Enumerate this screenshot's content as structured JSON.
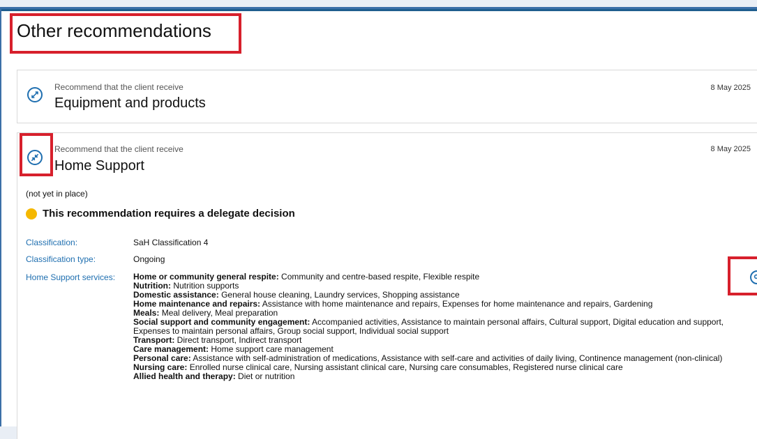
{
  "page": {
    "title": "Other recommendations",
    "colors": {
      "accent": "#1f6fb0",
      "annotation": "#d7202c",
      "warning_dot": "#f5b800"
    }
  },
  "cards": {
    "equipment": {
      "subtitle": "Recommend that the client receive",
      "title": "Equipment and products",
      "date": "8 May 2025",
      "icon": "expand-icon"
    },
    "home_support": {
      "subtitle": "Recommend that the client receive",
      "title": "Home Support",
      "date": "8 May 2025",
      "icon": "collapse-icon",
      "status": "(not yet in place)",
      "delegate_notice": "This recommendation requires a delegate decision",
      "classification_label": "Classification:",
      "classification_value": "SaH Classification 4",
      "classification_type_label": "Classification type:",
      "classification_type_value": "Ongoing",
      "services_label": "Home Support services:",
      "services": [
        {
          "name": "Home or community general respite:",
          "detail": " Community and centre-based respite, Flexible respite"
        },
        {
          "name": "Nutrition:",
          "detail": " Nutrition supports"
        },
        {
          "name": "Domestic assistance:",
          "detail": " General house cleaning, Laundry services, Shopping assistance"
        },
        {
          "name": "Home maintenance and repairs:",
          "detail": " Assistance with home maintenance and repairs, Expenses for home maintenance and repairs, Gardening"
        },
        {
          "name": "Meals:",
          "detail": " Meal delivery, Meal preparation"
        },
        {
          "name": "Social support and community engagement:",
          "detail": " Accompanied activities, Assistance to maintain personal affairs, Cultural support, Digital education and support, Expenses to maintain personal affairs, Group social support, Individual social support"
        },
        {
          "name": "Transport:",
          "detail": " Direct transport, Indirect transport"
        },
        {
          "name": "Care management:",
          "detail": " Home support care management"
        },
        {
          "name": "Personal care:",
          "detail": " Assistance with self-administration of medications, Assistance with self-care and activities of daily living, Continence management (non-clinical)"
        },
        {
          "name": "Nursing care:",
          "detail": " Enrolled nurse clinical care, Nursing assistant clinical care, Nursing care consumables, Registered nurse clinical care"
        },
        {
          "name": "Allied health and therapy:",
          "detail": " Diet or nutrition"
        }
      ]
    }
  }
}
